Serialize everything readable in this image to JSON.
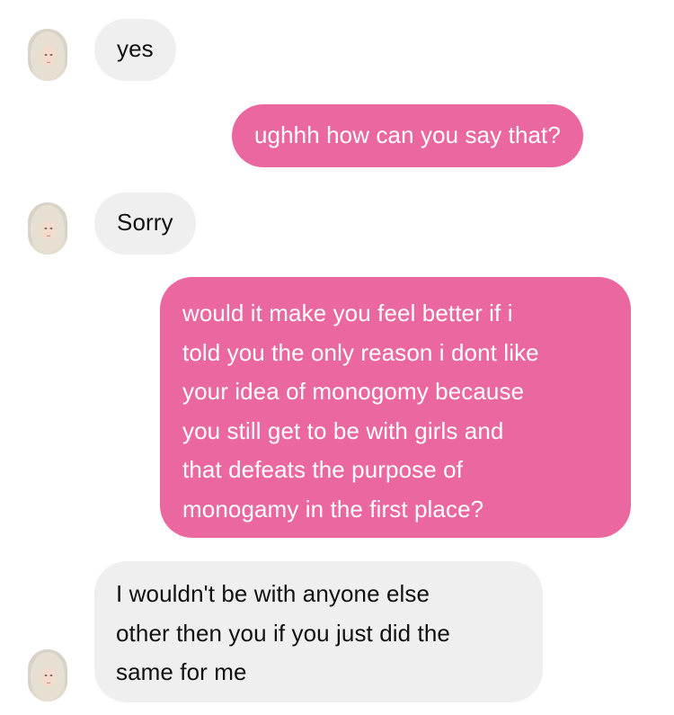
{
  "conversation": {
    "messages": [
      {
        "direction": "incoming",
        "lines": [
          "yes"
        ]
      },
      {
        "direction": "outgoing",
        "lines": [
          "ughhh how can you say that?"
        ]
      },
      {
        "direction": "incoming",
        "lines": [
          "Sorry"
        ]
      },
      {
        "direction": "outgoing",
        "lines": [
          "would it make you feel better if i",
          "told you the only reason i dont like",
          "your idea of monogomy because",
          "you still get to be with girls and",
          "that defeats the purpose of",
          "monogamy in the first place?"
        ]
      },
      {
        "direction": "incoming",
        "lines": [
          "I wouldn't be with anyone else",
          "other then you if you just did the",
          "same for me"
        ]
      }
    ]
  },
  "colors": {
    "incoming_bubble": "#efefef",
    "outgoing_bubble": "#ea679f",
    "incoming_text": "#111111",
    "outgoing_text": "#ffffff"
  }
}
